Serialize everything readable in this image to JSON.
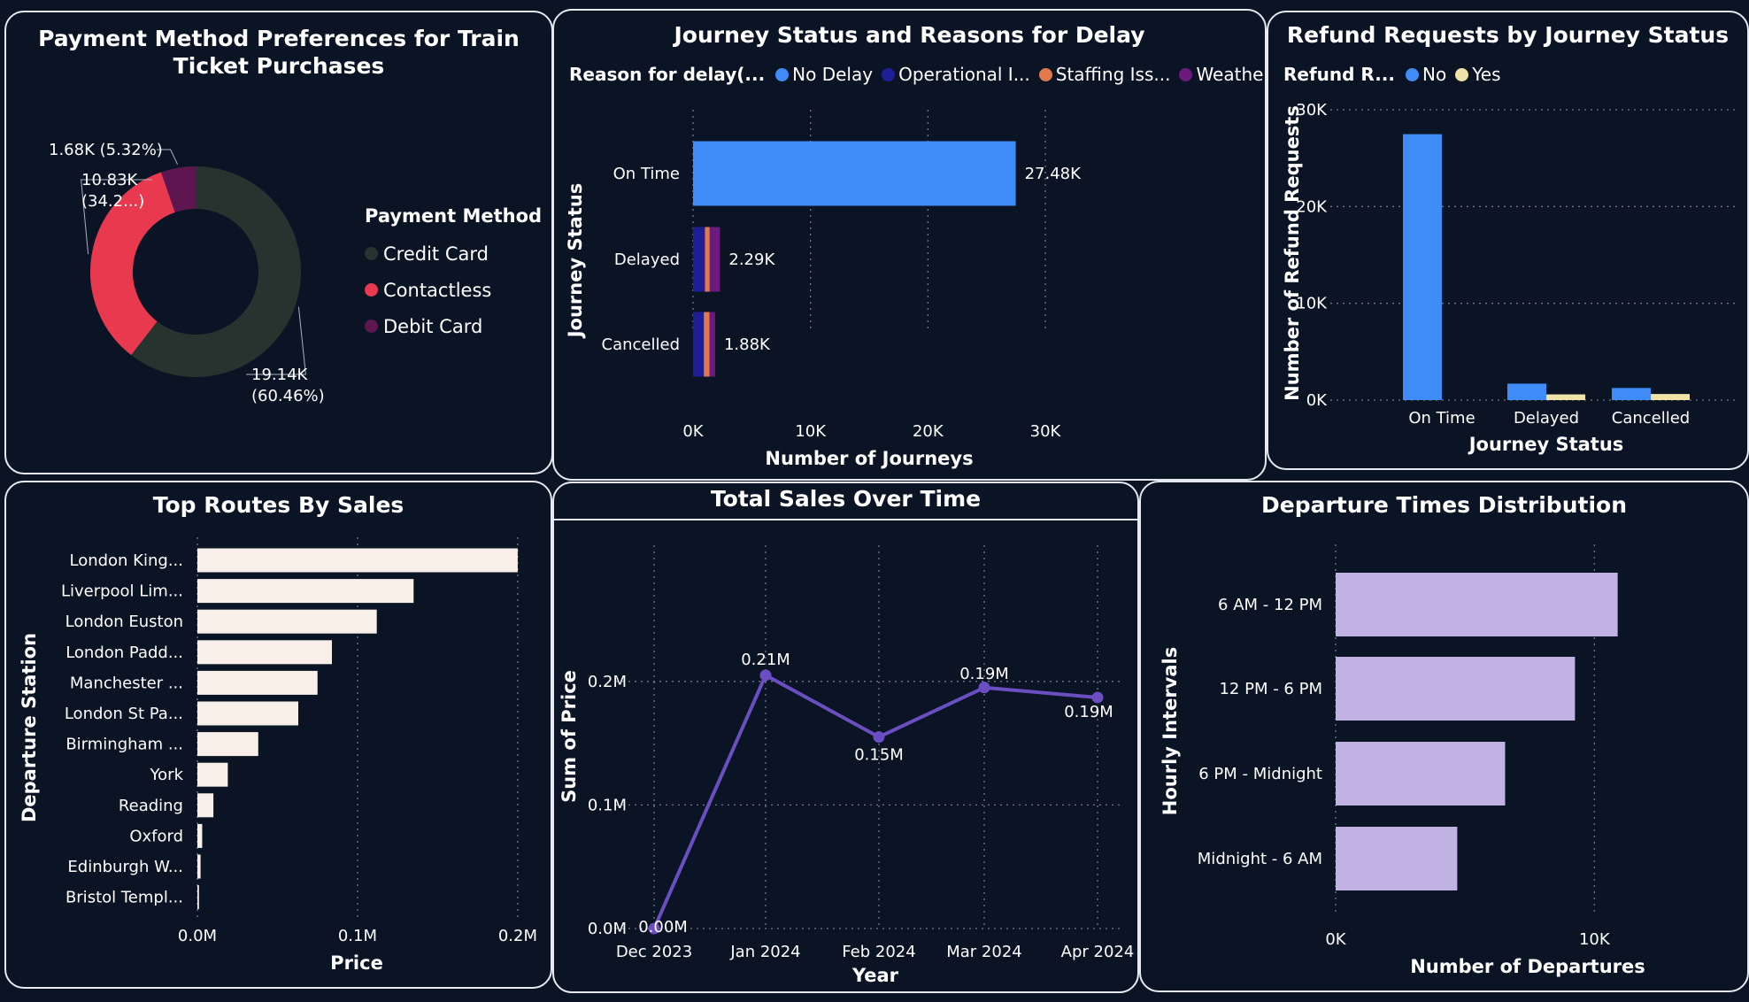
{
  "colors": {
    "background": "#0a1424",
    "border": "#e6e9ef",
    "grid": "#6f7a8c",
    "credit": "#26332f",
    "contactless": "#e8394f",
    "debit": "#5e1650",
    "no_delay": "#3f8cf8",
    "operational": "#1e1f96",
    "staffing": "#e07a4c",
    "weather": "#6c1a7e",
    "refund_no": "#3f8cf8",
    "refund_yes": "#f1e2a6",
    "routes_bar": "#f8f0e8",
    "sales_line": "#6b4fc2",
    "departures_bar": "#c0b3e3"
  },
  "panels": {
    "payment": {
      "title": "Payment Method Preferences for Train Ticket Purchases"
    },
    "journey": {
      "title": "Journey Status and Reasons for Delay"
    },
    "refund": {
      "title": "Refund Requests by Journey Status"
    },
    "routes": {
      "title": "Top Routes By Sales"
    },
    "sales": {
      "title": "Total Sales Over Time"
    },
    "departures": {
      "title": "Departure Times Distribution"
    }
  },
  "chart_data": [
    {
      "id": "payment",
      "type": "pie",
      "title": "Payment Method Preferences for Train Ticket Purchases",
      "legend_title": "Payment Method",
      "legend_position": "right",
      "labels": [
        "Credit Card",
        "Contactless",
        "Debit Card"
      ],
      "values": [
        19140,
        10830,
        1680
      ],
      "data_labels": [
        {
          "line1": "19.14K",
          "line2": "(60.46%)"
        },
        {
          "line1": "10.83K",
          "line2": "(34.2...)"
        },
        {
          "line1": "1.68K (5.32%)",
          "line2": ""
        }
      ]
    },
    {
      "id": "journey",
      "type": "bar",
      "orientation": "horizontal",
      "stacked": true,
      "title": "Journey Status and Reasons for Delay",
      "legend_title": "Reason for delay(...",
      "legend_position": "top-left",
      "xlabel": "Number of Journeys",
      "ylabel": "Journey Status",
      "xlim": [
        0,
        30000
      ],
      "x_ticks": [
        "0K",
        "10K",
        "20K",
        "30K"
      ],
      "categories": [
        "On Time",
        "Delayed",
        "Cancelled"
      ],
      "series": [
        {
          "name": "No Delay",
          "values": [
            27480,
            0,
            0
          ]
        },
        {
          "name": "Operational I...",
          "values": [
            0,
            1010,
            920
          ]
        },
        {
          "name": "Staffing Iss...",
          "values": [
            0,
            410,
            480
          ]
        },
        {
          "name": "Weather-...",
          "values": [
            0,
            870,
            480
          ]
        }
      ],
      "totals_labels": [
        "27.48K",
        "2.29K",
        "1.88K"
      ]
    },
    {
      "id": "refund",
      "type": "bar",
      "orientation": "vertical",
      "title": "Refund Requests by Journey Status",
      "legend_title": "Refund R...",
      "legend_position": "top-left",
      "xlabel": "Journey Status",
      "ylabel": "Number of Refund Requests",
      "ylim": [
        0,
        30000
      ],
      "y_ticks": [
        "0K",
        "10K",
        "20K",
        "30K"
      ],
      "categories": [
        "On Time",
        "Delayed",
        "Cancelled"
      ],
      "series": [
        {
          "name": "No",
          "values": [
            27480,
            1700,
            1250
          ]
        },
        {
          "name": "Yes",
          "values": [
            0,
            590,
            630
          ]
        }
      ]
    },
    {
      "id": "routes",
      "type": "bar",
      "orientation": "horizontal",
      "title": "Top Routes By Sales",
      "xlabel": "Price",
      "ylabel": "Departure Station",
      "xlim": [
        0,
        0.21
      ],
      "x_ticks": [
        "0.0M",
        "0.1M",
        "0.2M"
      ],
      "categories": [
        "London King...",
        "Liverpool Lim...",
        "London Euston",
        "London Padd...",
        "Manchester ...",
        "London St Pa...",
        "Birmingham ...",
        "York",
        "Reading",
        "Oxford",
        "Edinburgh W...",
        "Bristol Templ..."
      ],
      "values": [
        0.2,
        0.135,
        0.112,
        0.084,
        0.075,
        0.063,
        0.038,
        0.019,
        0.01,
        0.003,
        0.002,
        0.001
      ]
    },
    {
      "id": "sales",
      "type": "line",
      "title": "Total Sales Over Time",
      "xlabel": "Year",
      "ylabel": "Sum of Price",
      "ylim": [
        0,
        0.25
      ],
      "y_ticks": [
        "0.0M",
        "0.1M",
        "0.2M"
      ],
      "x": [
        "Dec 2023",
        "Jan 2024",
        "Feb 2024",
        "Mar 2024",
        "Apr 2024"
      ],
      "values": [
        0.0,
        0.205,
        0.155,
        0.195,
        0.187
      ],
      "data_labels": [
        "0.00M",
        "0.21M",
        "0.15M",
        "0.19M",
        "0.19M"
      ]
    },
    {
      "id": "departures",
      "type": "bar",
      "orientation": "horizontal",
      "title": "Departure Times Distribution",
      "xlabel": "Number of Departures",
      "ylabel": "Hourly Intervals",
      "xlim": [
        0,
        13000
      ],
      "x_ticks": [
        "0K",
        "10K"
      ],
      "categories": [
        "6 AM - 12 PM",
        "12 PM - 6 PM",
        "6 PM - Midnight",
        "Midnight - 6 AM"
      ],
      "values": [
        10900,
        9250,
        6550,
        4700
      ]
    }
  ]
}
